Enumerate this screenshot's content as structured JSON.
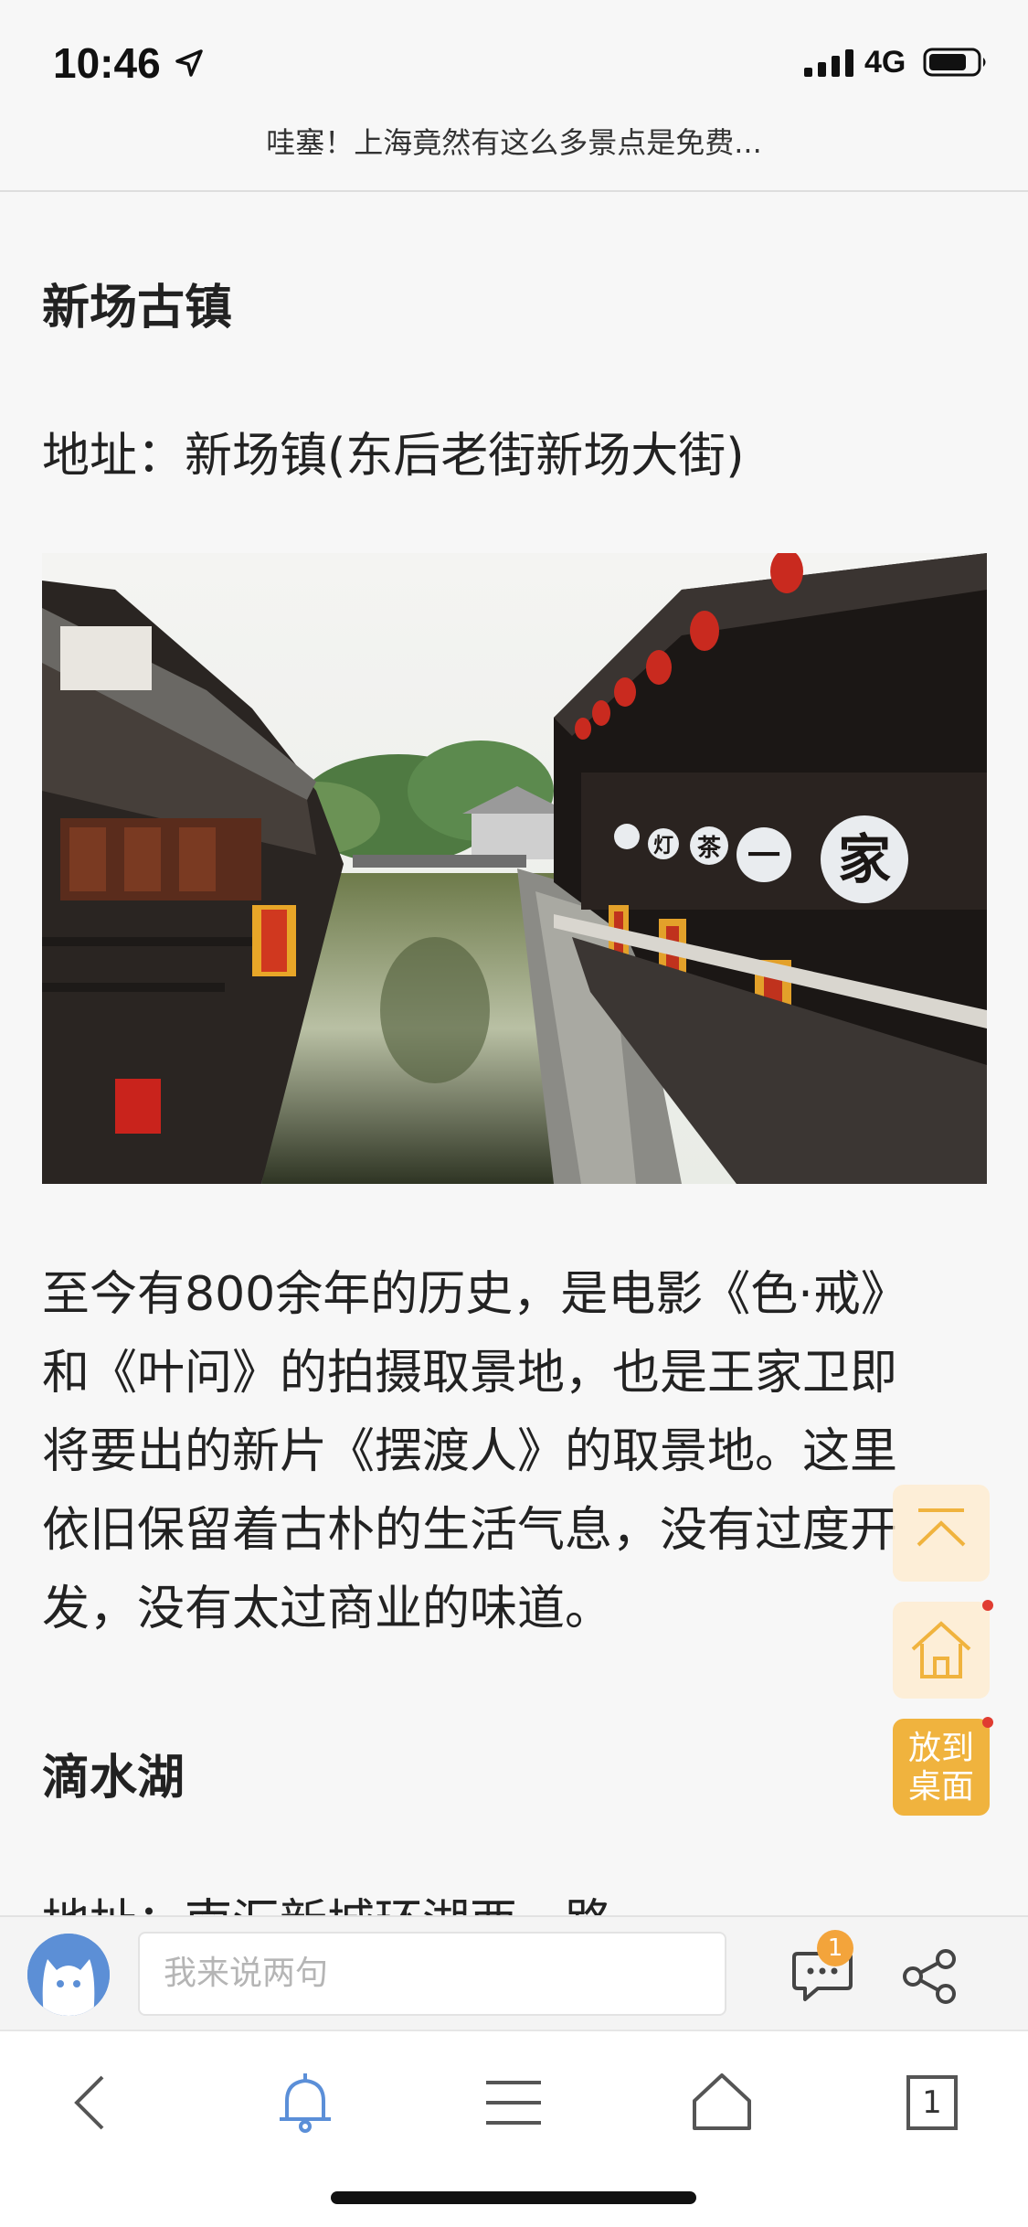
{
  "status_bar": {
    "time": "10:46",
    "network": "4G",
    "icons": [
      "location-arrow-icon",
      "signal-icon",
      "battery-icon"
    ]
  },
  "page_title": "哇塞！上海竟然有这么多景点是免费...",
  "article": {
    "section1_title": "新场古镇",
    "section1_address": "地址：新场镇(东后老街新场大街)",
    "photo": {
      "sign_chars": [
        "灯",
        "茶",
        "一",
        "家"
      ]
    },
    "paragraph1": [
      "至今有800余年的历史，是电影《色·戒》",
      "和《叶问》的拍摄取景地，也是王家卫即",
      "将要出的新片《摆渡人》的取景地。这里",
      "依旧保留着古朴的生活气息，没有过度开",
      "发，没有太过商业的味道。"
    ],
    "section2_title": "滴水湖",
    "section2_address": "地址：南汇新城环湖西一路"
  },
  "floating": {
    "desk_label_line1": "放到",
    "desk_label_line2": "桌面"
  },
  "comment_bar": {
    "input_placeholder": "我来说两句",
    "message_badge": "1"
  },
  "toolbar": {
    "tabs_count": "1",
    "icons": [
      "back-icon",
      "bell-icon",
      "menu-icon",
      "home-icon",
      "tabs-icon"
    ]
  },
  "colors": {
    "accent_orange": "#f0b33e",
    "bell_blue": "#5b8fd8",
    "badge_red": "#e03c31"
  }
}
